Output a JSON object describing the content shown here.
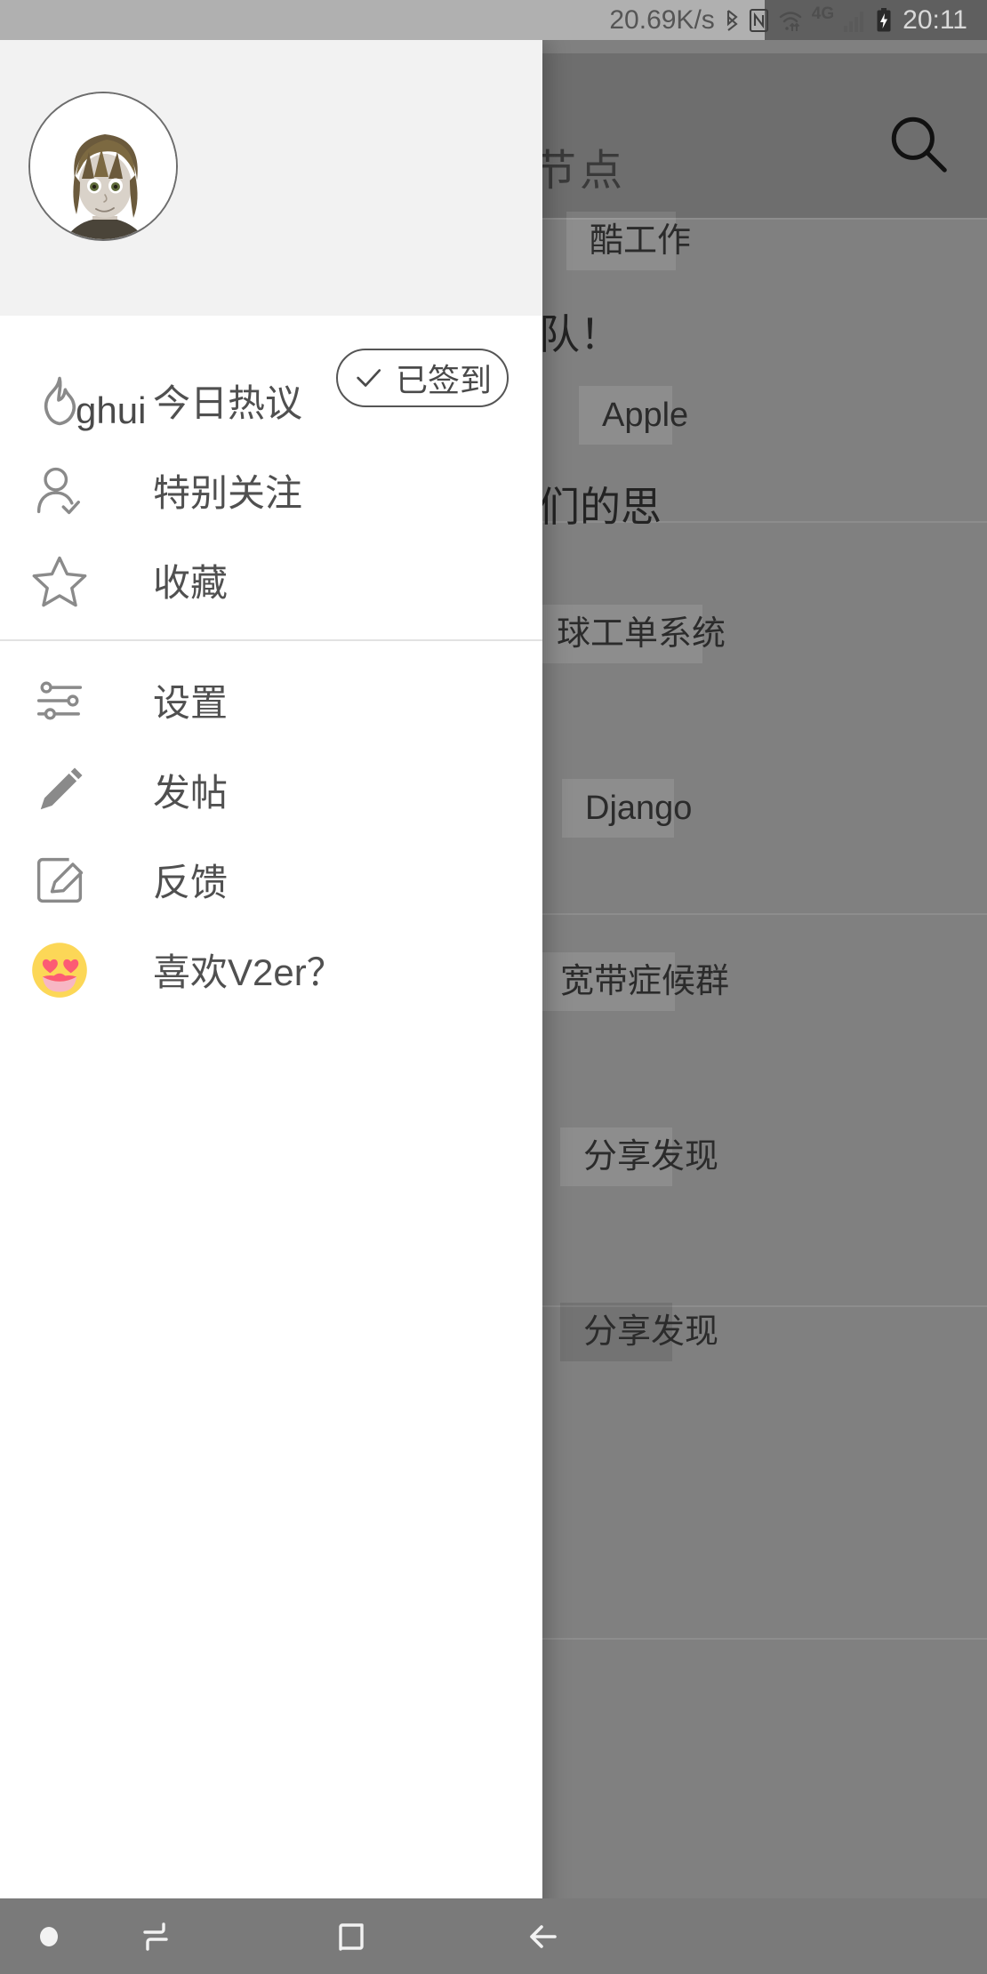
{
  "status_bar": {
    "network_speed": "20.69K/s",
    "icons": [
      "bluetooth-icon",
      "nfc-icon",
      "wifi-icon",
      "signal-icon",
      "battery-charging-icon"
    ],
    "network_type": "4G",
    "time": "20:11"
  },
  "drawer": {
    "profile": {
      "username": "ghui",
      "avatar_alt": "user-avatar",
      "checkin_button": {
        "label": "已签到",
        "icon": "check-icon"
      }
    },
    "menu_groups": [
      {
        "items": [
          {
            "label": "今日热议",
            "icon": "flame-icon"
          },
          {
            "label": "特别关注",
            "icon": "user-check-icon"
          },
          {
            "label": "收藏",
            "icon": "star-icon"
          }
        ]
      },
      {
        "items": [
          {
            "label": "设置",
            "icon": "sliders-icon"
          },
          {
            "label": "发帖",
            "icon": "pencil-icon"
          },
          {
            "label": "反馈",
            "icon": "note-edit-icon"
          },
          {
            "label": "喜欢V2er？",
            "icon": "heart-eyes-emoji"
          }
        ]
      }
    ]
  },
  "background": {
    "search_icon": "search-icon",
    "section_title": "节点",
    "tags": [
      "酷工作",
      "Apple",
      "球工单系统",
      "Django",
      "宽带症候群",
      "分享发现",
      "分享发现"
    ],
    "text_fragments": [
      "队！",
      "们的思"
    ]
  },
  "nav_bar": {
    "buttons": [
      {
        "name": "dot",
        "icon": "dot-icon"
      },
      {
        "name": "recents",
        "icon": "recents-icon"
      },
      {
        "name": "home",
        "icon": "home-square-icon"
      },
      {
        "name": "back",
        "icon": "back-arrow-icon"
      }
    ]
  },
  "colors": {
    "drawer_bg": "#ffffff",
    "header_bg": "#f2f2f2",
    "scrim": "#808080",
    "icon_gray": "#808080",
    "text_gray": "#505050",
    "emoji_yellow": "#FCD757",
    "emoji_pink": "#FC5B74"
  }
}
